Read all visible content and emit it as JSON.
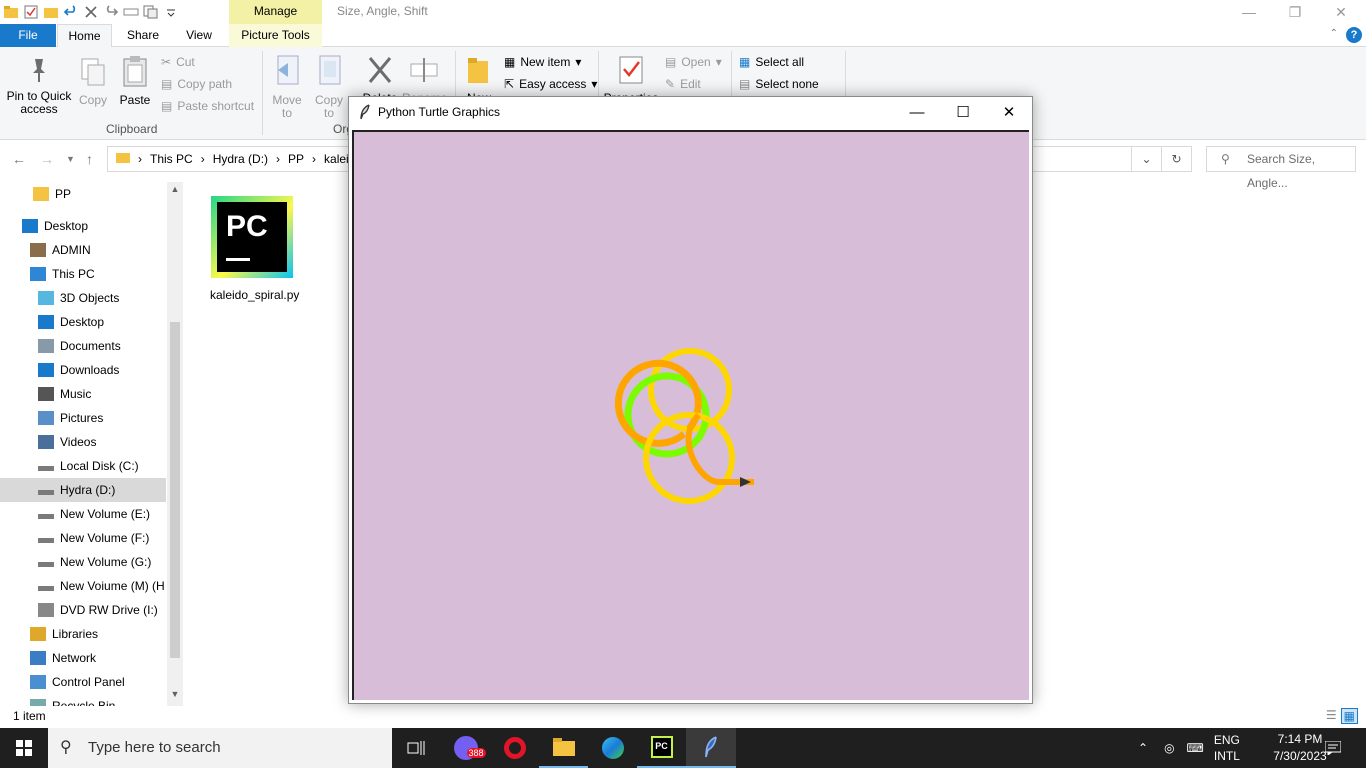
{
  "explorer": {
    "manage_tab": "Manage",
    "window_title": "Size, Angle, Shift",
    "tabs": {
      "file": "File",
      "home": "Home",
      "share": "Share",
      "view": "View",
      "picture_tools": "Picture Tools"
    },
    "ribbon": {
      "pin": "Pin to Quick access",
      "copy": "Copy",
      "paste": "Paste",
      "cut": "Cut",
      "copy_path": "Copy path",
      "paste_shortcut": "Paste shortcut",
      "clipboard_label": "Clipboard",
      "move_to": "Move to",
      "copy_to": "Copy to",
      "delete": "Delete",
      "rename": "Rename",
      "organize_label": "Organize",
      "new_folder": "New",
      "new_item": "New item",
      "easy_access": "Easy access",
      "properties": "Properties",
      "open": "Open",
      "edit": "Edit",
      "select_all": "Select all",
      "select_none": "Select none"
    },
    "address": {
      "parts": [
        "This PC",
        "Hydra (D:)",
        "PP",
        "kaleid"
      ]
    },
    "search_placeholder": "Search Size, Angle...",
    "nav": [
      {
        "label": "PP",
        "icon": "folder-icon"
      },
      {
        "label": "Desktop",
        "icon": "desktop-icon"
      },
      {
        "label": "ADMIN",
        "icon": "user-icon"
      },
      {
        "label": "This PC",
        "icon": "pc-icon"
      },
      {
        "label": "3D Objects",
        "icon": "cube-icon"
      },
      {
        "label": "Desktop",
        "icon": "desktop-icon"
      },
      {
        "label": "Documents",
        "icon": "documents-icon"
      },
      {
        "label": "Downloads",
        "icon": "download-icon"
      },
      {
        "label": "Music",
        "icon": "music-icon"
      },
      {
        "label": "Pictures",
        "icon": "pictures-icon"
      },
      {
        "label": "Videos",
        "icon": "videos-icon"
      },
      {
        "label": "Local Disk (C:)",
        "icon": "drive-icon"
      },
      {
        "label": "Hydra (D:)",
        "icon": "drive-icon"
      },
      {
        "label": "New Volume (E:)",
        "icon": "drive-icon"
      },
      {
        "label": "New Volume (F:)",
        "icon": "drive-icon"
      },
      {
        "label": "New Volume (G:)",
        "icon": "drive-icon"
      },
      {
        "label": "New Voiume (M) (H",
        "icon": "drive-icon"
      },
      {
        "label": "DVD RW Drive (I:)",
        "icon": "dvd-icon"
      },
      {
        "label": "Libraries",
        "icon": "libraries-icon"
      },
      {
        "label": "Network",
        "icon": "network-icon"
      },
      {
        "label": "Control Panel",
        "icon": "control-panel-icon"
      },
      {
        "label": "Recycle Bin",
        "icon": "recycle-bin-icon"
      }
    ],
    "file": {
      "name": "kaleido_spiral.py",
      "icon_text": "PC"
    },
    "status": "1 item"
  },
  "turtle": {
    "title": "Python Turtle Graphics",
    "canvas_bg": "#d7bdd7"
  },
  "taskbar": {
    "search_placeholder": "Type here to search",
    "badge": "388",
    "lang": "ENG",
    "layout": "INTL",
    "time": "7:14 PM",
    "date": "7/30/2023"
  },
  "colors": {
    "accent": "#1979ca",
    "orange": "#ffa500",
    "yellow": "#ffd700",
    "green": "#7cfc00"
  }
}
